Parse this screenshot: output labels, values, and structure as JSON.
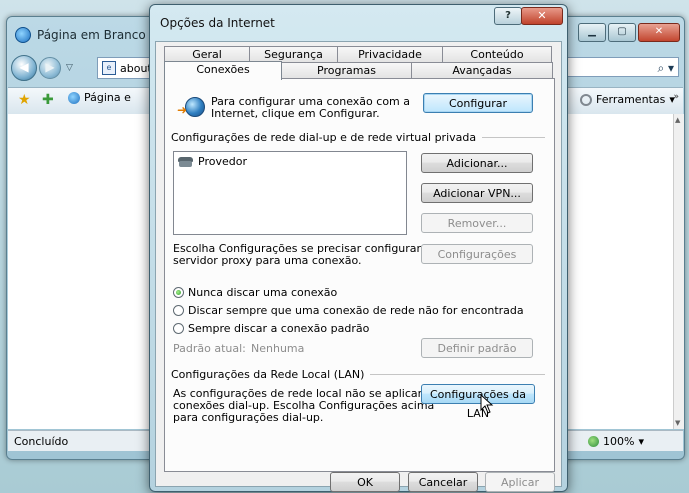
{
  "ie": {
    "title": "Página em Branco - M",
    "address": "about",
    "search_glyph": "⌕ ▾",
    "tab_label": "Página e",
    "tools_label": "Ferramentas",
    "status": "Concluído",
    "zoom": "100%"
  },
  "dialog": {
    "title": "Opções da Internet",
    "help": "?",
    "close": "✕",
    "tabs_back": [
      "Geral",
      "Segurança",
      "Privacidade",
      "Conteúdo"
    ],
    "tabs_front": [
      "Conexões",
      "Programas",
      "Avançadas"
    ],
    "active_tab": "Conexões",
    "setup_text_1": "Para configurar uma conexão com a",
    "setup_text_2": "Internet, clique em Configurar.",
    "setup_button": "Configurar",
    "dialup_heading": "Configurações de rede dial-up e de rede virtual privada",
    "dialup_list": [
      "Provedor"
    ],
    "add_button": "Adicionar...",
    "add_vpn_button": "Adicionar VPN...",
    "remove_button": "Remover...",
    "proxy_text_1": "Escolha Configurações se precisar configurar um",
    "proxy_text_2": "servidor proxy para uma conexão.",
    "settings_button": "Configurações",
    "radio_never": "Nunca discar uma conexão",
    "radio_when_no_network": "Discar sempre que uma conexão de rede não for encontrada",
    "radio_always": "Sempre discar a conexão padrão",
    "radio_selected": "never",
    "default_label": "Padrão atual:",
    "default_value": "Nenhuma",
    "set_default_button": "Definir padrão",
    "lan_heading": "Configurações da Rede Local (LAN)",
    "lan_text_1": "As configurações de rede local não se aplicam a",
    "lan_text_2": "conexões dial-up. Escolha Configurações acima",
    "lan_text_3": "para configurações dial-up.",
    "lan_button": "Configurações da LAN",
    "ok_button": "OK",
    "cancel_button": "Cancelar",
    "apply_button": "Aplicar"
  }
}
